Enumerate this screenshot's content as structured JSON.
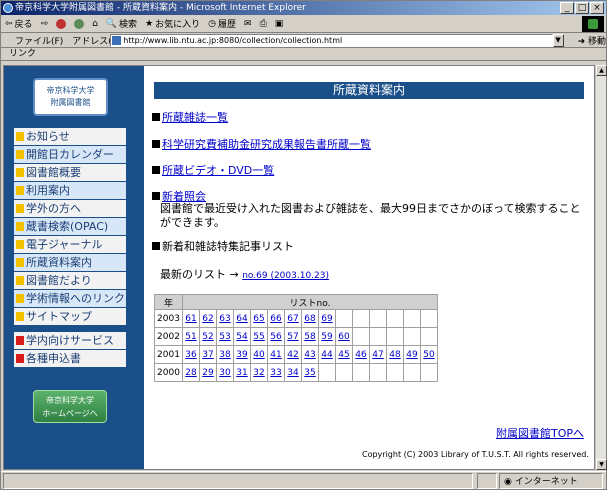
{
  "window": {
    "title": "帝京科学大学附属図書館 - 所蔵資料案内 - Microsoft Internet Explorer"
  },
  "toolbar": {
    "back": "戻る",
    "search": "検索",
    "favorites": "お気に入り",
    "history": "履歴"
  },
  "address": {
    "file_menu": "ファイル(F)",
    "label": "アドレス(D)",
    "url": "http://www.lib.ntu.ac.jp:8080/collection/collection.html",
    "go": "移動"
  },
  "linkbar": {
    "label": "リンク"
  },
  "sidebar": {
    "logo_line1": "帝京科学大学",
    "logo_line2": "附属図書館",
    "items": [
      {
        "label": "お知らせ"
      },
      {
        "label": "開館日カレンダー"
      },
      {
        "label": "図書館概要"
      },
      {
        "label": "利用案内"
      },
      {
        "label": "学外の方へ"
      },
      {
        "label": "蔵書検索(OPAC)"
      },
      {
        "label": "電子ジャーナル"
      },
      {
        "label": "所蔵資料案内"
      },
      {
        "label": "図書館だより"
      },
      {
        "label": "学術情報へのリンク"
      },
      {
        "label": "サイトマップ"
      }
    ],
    "service_items": [
      {
        "label": "学内向けサービス"
      },
      {
        "label": "各種申込書"
      }
    ],
    "home_line1": "帝京科学大学",
    "home_line2": "ホームページへ"
  },
  "main": {
    "banner": "所蔵資料案内",
    "link_journals": "所蔵雑誌一覧",
    "link_reports": "科学研究費補助金研究成果報告書所蔵一覧",
    "link_videos": "所蔵ビデオ・DVD一覧",
    "link_new": "新着照会",
    "new_desc": "図書館で最近受け入れた図書および雑誌を、最大99日までさかのぼって検索することができます。",
    "new_journals_heading": "新着和雑誌特集記事リスト",
    "latest_label": "最新のリスト →",
    "latest_link": "no.69 (2003.10.23)",
    "table": {
      "col_year": "年",
      "col_list": "リストno.",
      "rows": [
        {
          "year": "2003",
          "nums": [
            "61",
            "62",
            "63",
            "64",
            "65",
            "66",
            "67",
            "68",
            "69",
            "",
            "",
            "",
            "",
            "",
            ""
          ]
        },
        {
          "year": "2002",
          "nums": [
            "51",
            "52",
            "53",
            "54",
            "55",
            "56",
            "57",
            "58",
            "59",
            "60",
            "",
            "",
            "",
            "",
            ""
          ]
        },
        {
          "year": "2001",
          "nums": [
            "36",
            "37",
            "38",
            "39",
            "40",
            "41",
            "42",
            "43",
            "44",
            "45",
            "46",
            "47",
            "48",
            "49",
            "50"
          ]
        },
        {
          "year": "2000",
          "nums": [
            "28",
            "29",
            "30",
            "31",
            "32",
            "33",
            "34",
            "35",
            "",
            "",
            "",
            "",
            "",
            "",
            ""
          ]
        }
      ]
    },
    "top_link": "附属図書館TOPへ",
    "copyright": "Copyright (C) 2003 Library of T.U.S.T. All rights reserved."
  },
  "status": {
    "left": "",
    "zone": "インターネット"
  }
}
